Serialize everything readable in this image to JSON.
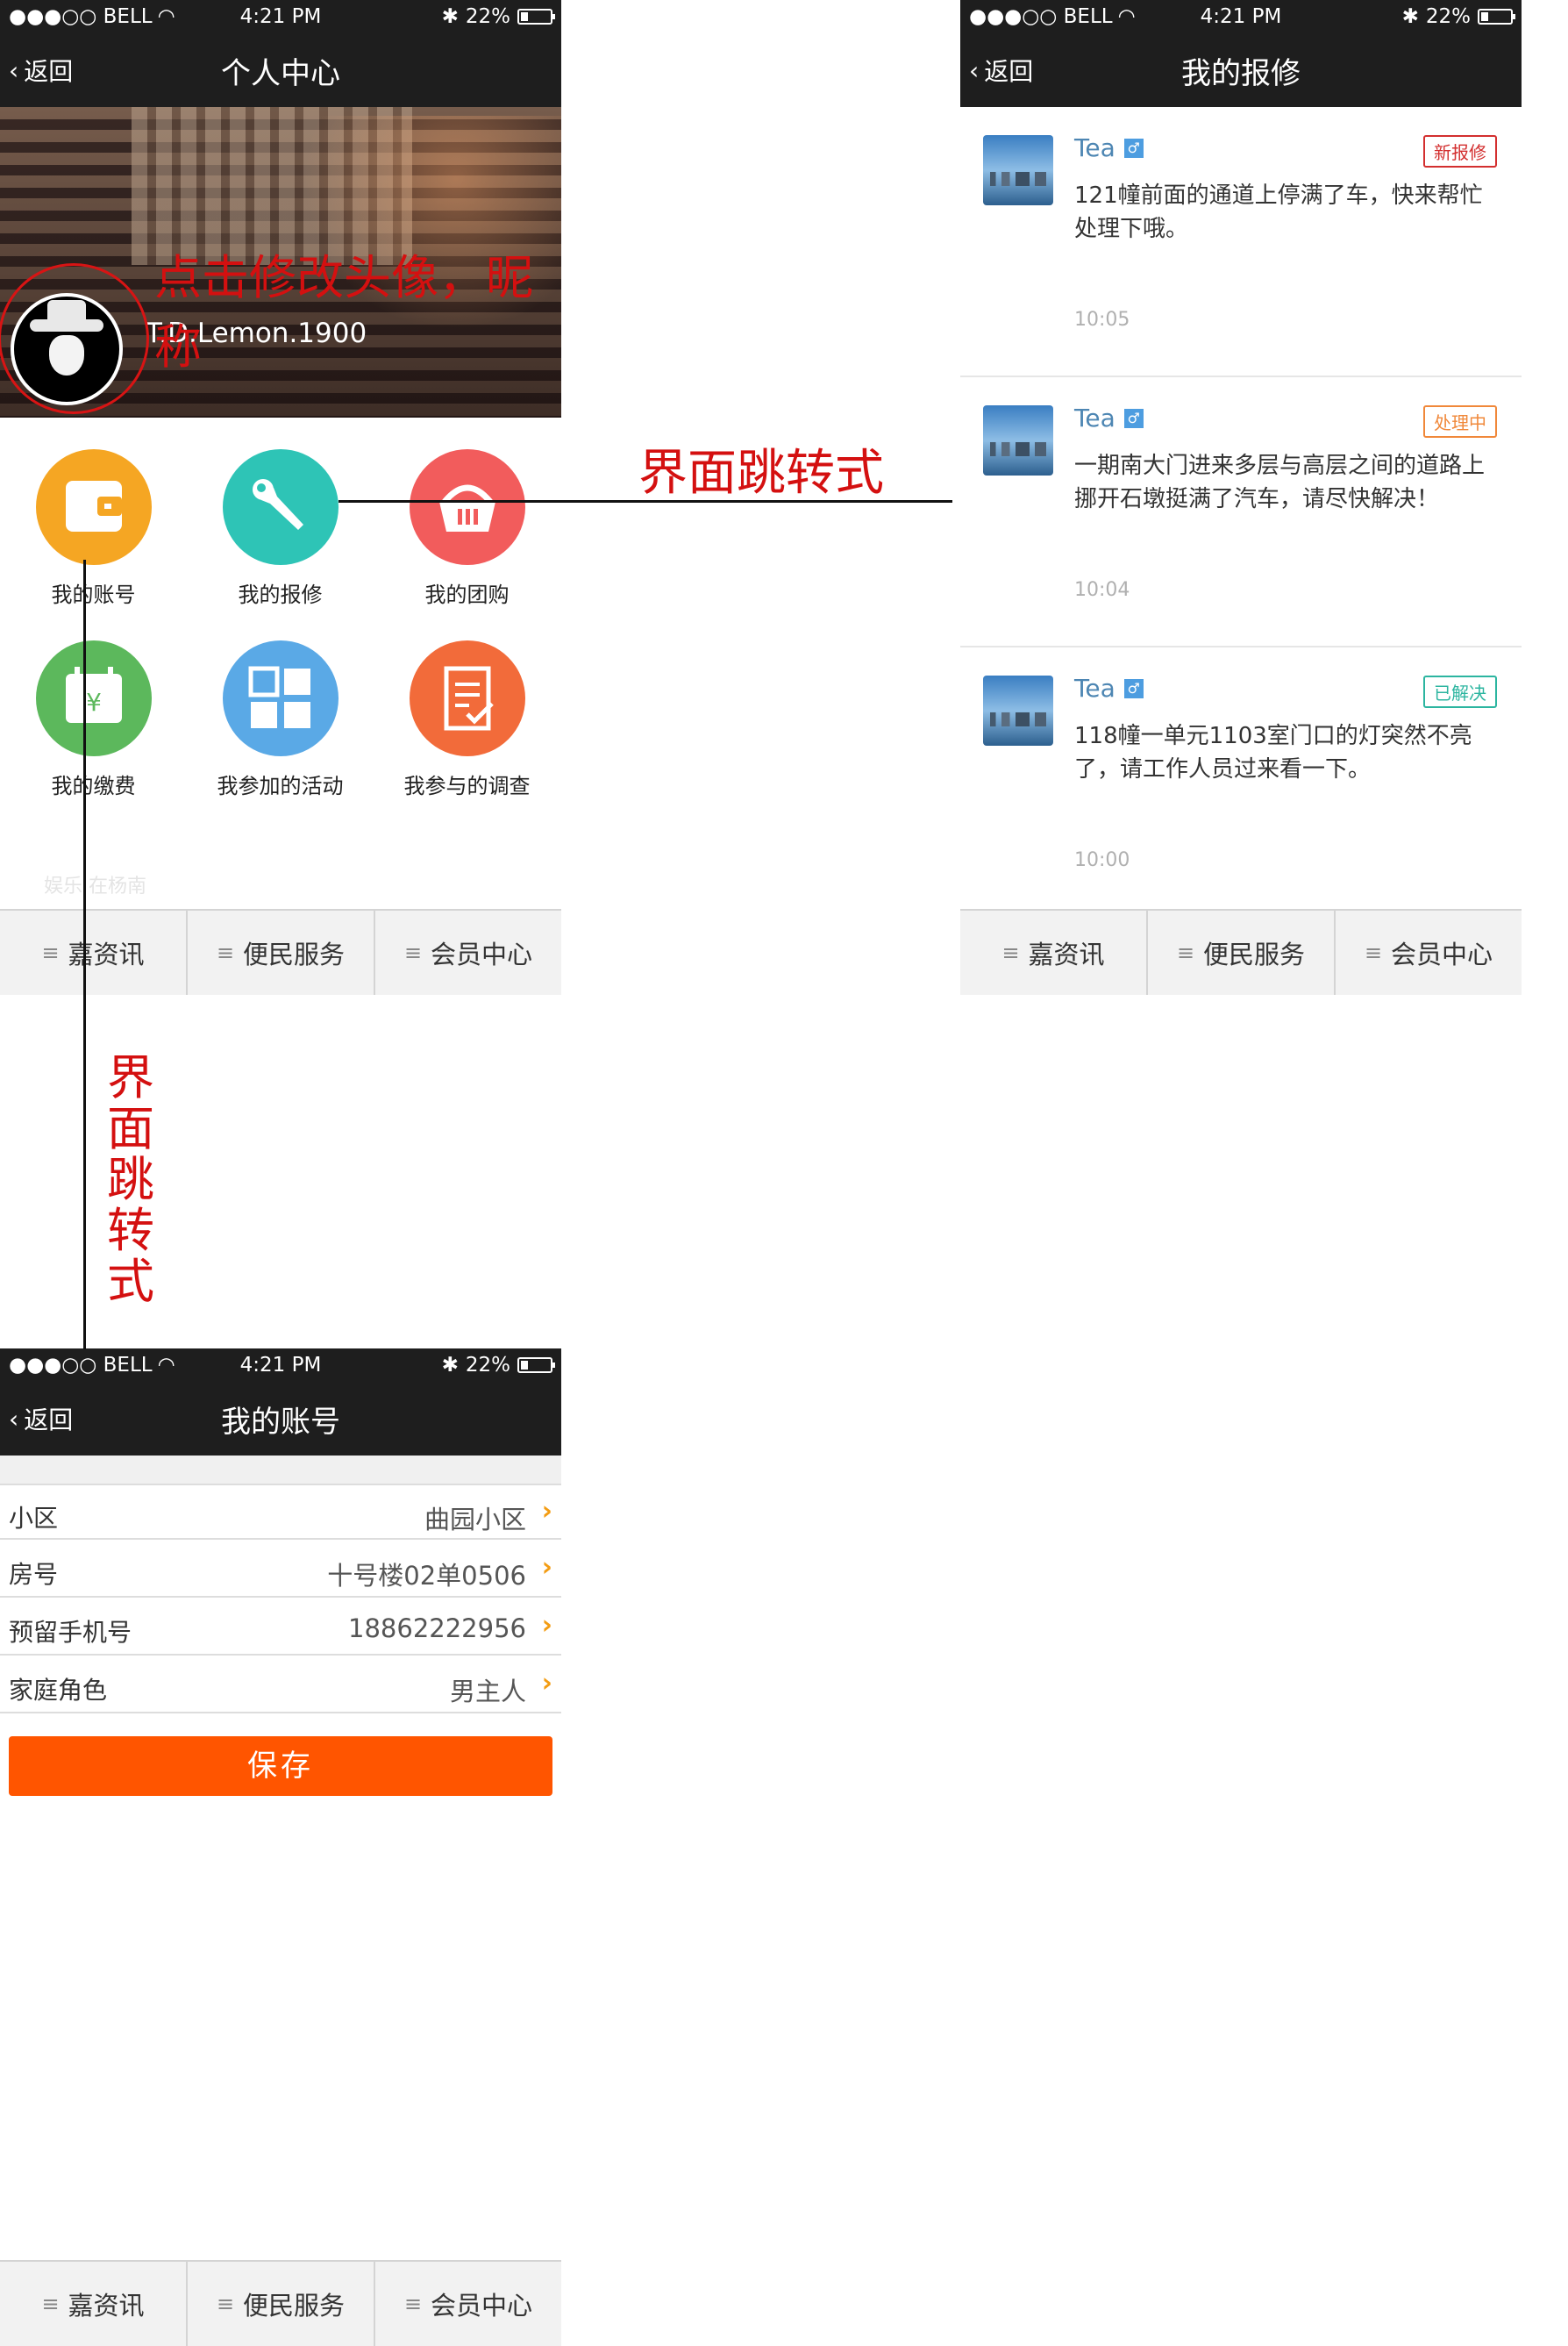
{
  "status": {
    "carrier": "●●●○○ BELL",
    "wifi_icon": "wifi-icon",
    "time": "4:21 PM",
    "bluetooth": "✱",
    "battery": "22%"
  },
  "nav": {
    "back": "返回"
  },
  "tabbar": {
    "tabs": [
      {
        "label": "嘉资讯"
      },
      {
        "label": "便民服务"
      },
      {
        "label": "会员中心"
      }
    ]
  },
  "profile": {
    "title": "个人中心",
    "nickname": "T.D.Lemon.1900",
    "annotation": "点击修改头像，昵称",
    "grid": [
      {
        "label": "我的账号",
        "icon": "wallet-icon",
        "color": "#f5a623"
      },
      {
        "label": "我的报修",
        "icon": "wrench-icon",
        "color": "#2ec4b6"
      },
      {
        "label": "我的团购",
        "icon": "basket-icon",
        "color": "#f25c5c"
      },
      {
        "label": "我的缴费",
        "icon": "calendar-yen-icon",
        "color": "#5cb85c"
      },
      {
        "label": "我参加的活动",
        "icon": "grid-icon",
        "color": "#5aa9e6"
      },
      {
        "label": "我参与的调查",
        "icon": "survey-icon",
        "color": "#f26b3a"
      }
    ],
    "ghost_text": "娱乐  在杨南"
  },
  "repairs": {
    "title": "我的报修",
    "items": [
      {
        "user": "Tea",
        "gender": "♂",
        "status": "新报修",
        "status_color": "#d32f2f",
        "text": "121幢前面的通道上停满了车，快来帮忙处理下哦。",
        "time": "10:05"
      },
      {
        "user": "Tea",
        "gender": "♂",
        "status": "处理中",
        "status_color": "#f0883a",
        "text": "一期南大门进来多层与高层之间的道路上挪开石墩挺满了汽车，请尽快解决！",
        "time": "10:04"
      },
      {
        "user": "Tea",
        "gender": "♂",
        "status": "已解决",
        "status_color": "#2cb5a0",
        "text": "118幢一单元1103室门口的灯突然不亮了，请工作人员过来看一下。",
        "time": "10:00"
      }
    ]
  },
  "account": {
    "title": "我的账号",
    "rows": [
      {
        "label": "小区",
        "value": "曲园小区"
      },
      {
        "label": "房号",
        "value": "十号楼02单0506"
      },
      {
        "label": "预留手机号",
        "value": "18862222956"
      },
      {
        "label": "家庭角色",
        "value": "男主人"
      }
    ],
    "save": "保存"
  },
  "annotations": {
    "jump_h": "界面跳转式",
    "jump_v": "界面跳转式"
  }
}
